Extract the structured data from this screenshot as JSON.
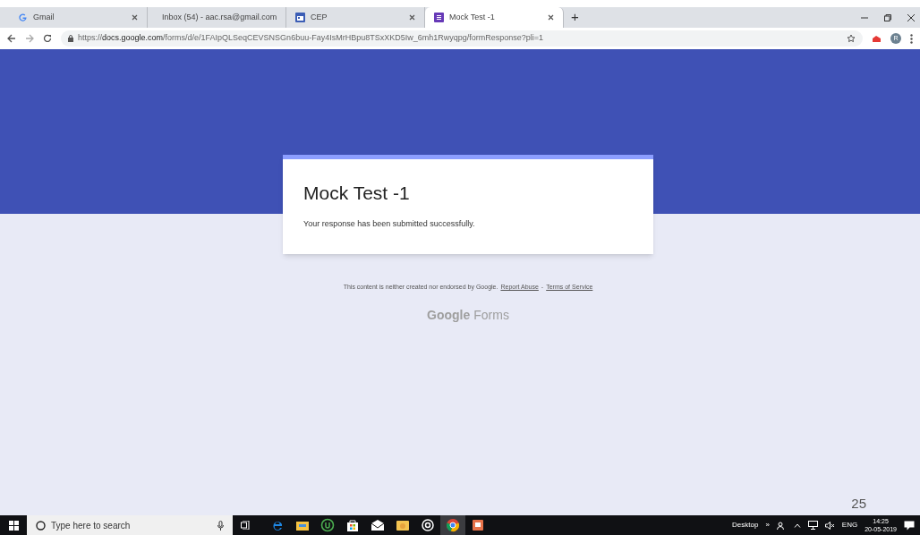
{
  "browser": {
    "tabs": [
      {
        "kind": "google",
        "title": "Gmail",
        "selected": false
      },
      {
        "kind": "gmail",
        "title": "Inbox (54) - aac.rsa@gmail.com",
        "selected": false
      },
      {
        "kind": "calendar",
        "title": "CEP",
        "selected": false
      },
      {
        "kind": "forms",
        "title": "Mock Test -1",
        "selected": true
      }
    ],
    "new_tab": "+",
    "address": "https://**docs.google.com**/forms/d/e/1FAIpQLSeqCEVSNSGn6buu-Fay4IsMrHBpu8TSxXKD5Iw_6mh1Rwyqpg/formResponse?pli=1",
    "profile_initial": "R"
  },
  "form": {
    "title": "Mock Test -1",
    "message": "Your response has been submitted successfully."
  },
  "footer": {
    "notice": "This content is neither created nor endorsed by Google.",
    "links": [
      "Report Abuse",
      "Terms of Service"
    ],
    "separator": "-",
    "brand": [
      "Google",
      "Forms"
    ]
  },
  "page_number": "25",
  "taskbar": {
    "search_placeholder": "Type here to search",
    "apps": [
      {
        "kind": "edge",
        "selected": false
      },
      {
        "kind": "files",
        "selected": false
      },
      {
        "kind": "torrent",
        "selected": false
      },
      {
        "kind": "store",
        "selected": false
      },
      {
        "kind": "mail",
        "selected": false
      },
      {
        "kind": "folder",
        "selected": false
      },
      {
        "kind": "target",
        "selected": false
      },
      {
        "kind": "chrome",
        "selected": true
      },
      {
        "kind": "slides",
        "selected": false
      }
    ],
    "desktop_label": "Desktop",
    "chevron": "»",
    "language": "ENG",
    "time": "14:25",
    "date": "20-05-2019"
  }
}
